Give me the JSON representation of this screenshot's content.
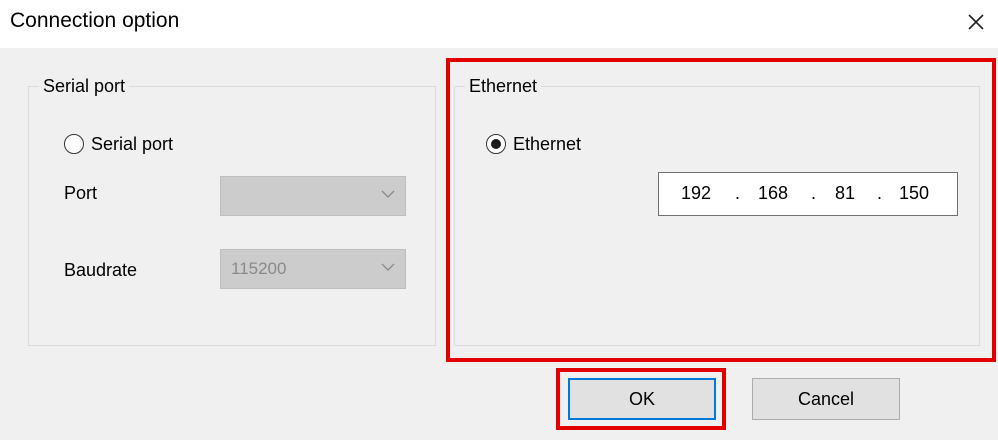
{
  "window": {
    "title": "Connection option",
    "close_icon": "close-icon"
  },
  "serial_group": {
    "label": "Serial port",
    "radio_label": "Serial port",
    "radio_checked": false,
    "port_label": "Port",
    "port_value": "",
    "baud_label": "Baudrate",
    "baud_value": "115200"
  },
  "ethernet_group": {
    "label": "Ethernet",
    "radio_label": "Ethernet",
    "radio_checked": true,
    "ip": {
      "o1": "192",
      "o2": "168",
      "o3": "81",
      "o4": "150",
      "sep": "."
    }
  },
  "buttons": {
    "ok": "OK",
    "cancel": "Cancel"
  },
  "colors": {
    "highlight": "#e00000",
    "focus": "#0078d7"
  }
}
